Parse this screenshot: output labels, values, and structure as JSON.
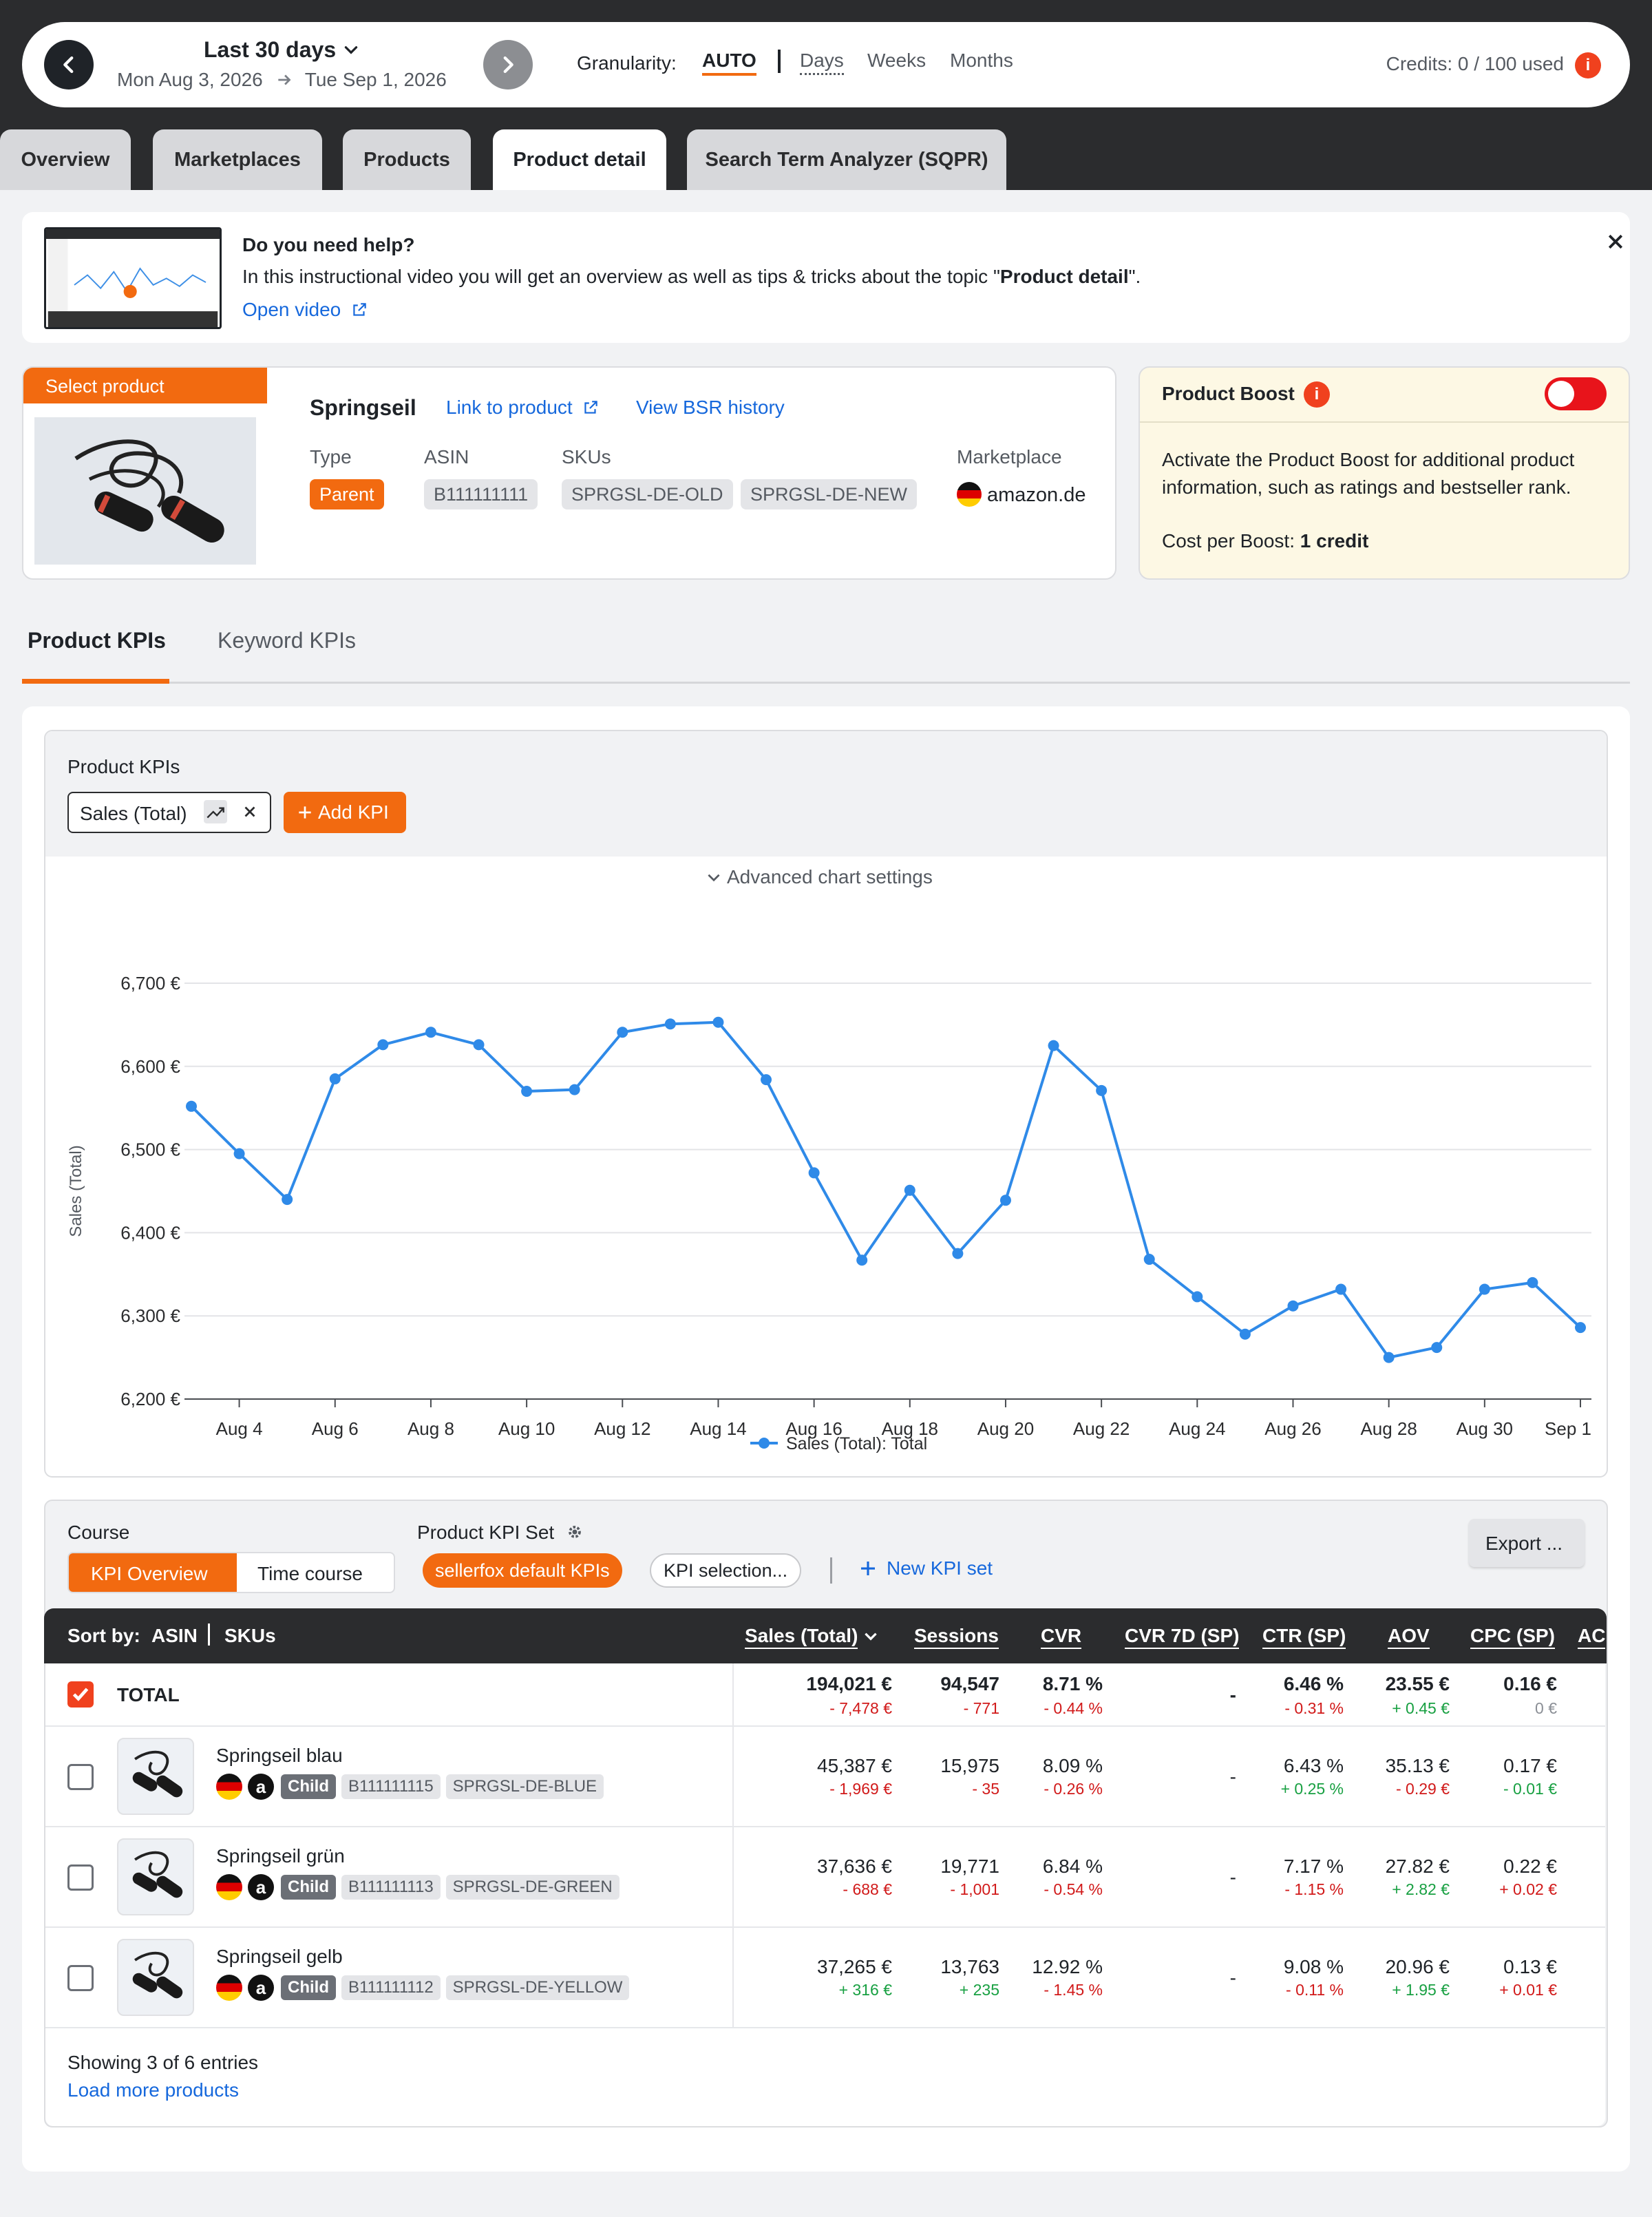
{
  "header": {
    "range_label": "Last 30 days",
    "date_from": "Mon Aug 3, 2026",
    "date_to": "Tue Sep 1, 2026",
    "granularity_label": "Granularity:",
    "granularity_options": [
      "AUTO",
      "Days",
      "Weeks",
      "Months"
    ],
    "granularity_selected": "AUTO",
    "credits": "Credits: 0 / 100 used"
  },
  "tabs": [
    "Overview",
    "Marketplaces",
    "Products",
    "Product detail",
    "Search Term Analyzer (SQPR)"
  ],
  "active_tab": "Product detail",
  "help": {
    "title": "Do you need help?",
    "text_prefix": "In this instructional video you will get an overview as well as tips & tricks about the topic \"",
    "text_bold": "Product detail",
    "text_suffix": "\".",
    "link": "Open video"
  },
  "product": {
    "select_label": "Select product",
    "name": "Springseil",
    "link_product": "Link to product",
    "link_bsr": "View BSR history",
    "type_label": "Type",
    "type_value": "Parent",
    "asin_label": "ASIN",
    "asin_value": "B111111111",
    "skus_label": "SKUs",
    "skus": [
      "SPRGSL-DE-OLD",
      "SPRGSL-DE-NEW"
    ],
    "marketplace_label": "Marketplace",
    "marketplace_value": "amazon.de"
  },
  "boost": {
    "title": "Product Boost",
    "text": "Activate the Product Boost for additional product information, such as ratings and bestseller rank.",
    "cost_label": "Cost per Boost:",
    "cost_value": "1 credit",
    "enabled": false
  },
  "kpi_tabs": [
    "Product KPIs",
    "Keyword KPIs"
  ],
  "kpi_active": "Product KPIs",
  "chart_panel": {
    "title": "Product KPIs",
    "kpi_chip": "Sales (Total)",
    "add_kpi": "Add KPI",
    "advanced": "Advanced chart settings"
  },
  "chart_data": {
    "type": "line",
    "title": "",
    "xlabel": "",
    "ylabel": "Sales (Total)",
    "ylim": [
      6200,
      6700
    ],
    "y_ticks": [
      "6,200 €",
      "6,300 €",
      "6,400 €",
      "6,500 €",
      "6,600 €",
      "6,700 €"
    ],
    "x_tick_labels": [
      "Aug 4",
      "Aug 6",
      "Aug 8",
      "Aug 10",
      "Aug 12",
      "Aug 14",
      "Aug 16",
      "Aug 18",
      "Aug 20",
      "Aug 22",
      "Aug 24",
      "Aug 26",
      "Aug 28",
      "Aug 30",
      "Sep 1"
    ],
    "grid": true,
    "legend_position": "bottom-center",
    "color": "#2f8ae8",
    "x": [
      "Aug 3",
      "Aug 4",
      "Aug 5",
      "Aug 6",
      "Aug 7",
      "Aug 8",
      "Aug 9",
      "Aug 10",
      "Aug 11",
      "Aug 12",
      "Aug 13",
      "Aug 14",
      "Aug 15",
      "Aug 16",
      "Aug 17",
      "Aug 18",
      "Aug 19",
      "Aug 20",
      "Aug 21",
      "Aug 22",
      "Aug 23",
      "Aug 24",
      "Aug 25",
      "Aug 26",
      "Aug 27",
      "Aug 28",
      "Aug 29",
      "Aug 30",
      "Aug 31",
      "Sep 1"
    ],
    "series": [
      {
        "name": "Sales (Total): Total",
        "values": [
          6552,
          6495,
          6440,
          6585,
          6626,
          6641,
          6626,
          6570,
          6572,
          6641,
          6651,
          6653,
          6584,
          6472,
          6367,
          6451,
          6375,
          6439,
          6625,
          6571,
          6368,
          6323,
          6278,
          6312,
          6332,
          6250,
          6262,
          6332,
          6340,
          6286
        ]
      }
    ]
  },
  "course": {
    "label": "Course",
    "options": [
      "KPI Overview",
      "Time course"
    ],
    "selected": "KPI Overview",
    "kpi_set_label": "Product KPI Set",
    "kpi_set_chip": "sellerfox default KPIs",
    "kpi_selection": "KPI selection...",
    "new_kpi_set": "New KPI set",
    "export": "Export ..."
  },
  "table": {
    "sort_label": "Sort by:",
    "sort_options": [
      "ASIN",
      "SKUs"
    ],
    "columns": [
      "Sales (Total)",
      "Sessions",
      "CVR",
      "CVR 7D (SP)",
      "CTR (SP)",
      "AOV",
      "CPC (SP)",
      "AC"
    ],
    "total": {
      "label": "TOTAL",
      "values": [
        "194,021 €",
        "94,547",
        "8.71 %",
        "-",
        "6.46 %",
        "23.55 €",
        "0.16 €"
      ],
      "deltas": [
        "- 7,478 €",
        "- 771",
        "- 0.44 %",
        "",
        "- 0.31 %",
        "+ 0.45 €",
        "0 €"
      ],
      "delta_colors": [
        "red",
        "red",
        "red",
        "",
        "red",
        "green",
        "gray"
      ]
    },
    "rows": [
      {
        "name": "Springseil blau",
        "type": "Child",
        "asin": "B111111115",
        "sku": "SPRGSL-DE-BLUE",
        "values": [
          "45,387 €",
          "15,975",
          "8.09 %",
          "-",
          "6.43 %",
          "35.13 €",
          "0.17 €"
        ],
        "deltas": [
          "- 1,969 €",
          "- 35",
          "- 0.26 %",
          "",
          "+ 0.25 %",
          "- 0.29 €",
          "- 0.01 €"
        ],
        "delta_colors": [
          "red",
          "red",
          "red",
          "",
          "green",
          "red",
          "green"
        ]
      },
      {
        "name": "Springseil grün",
        "type": "Child",
        "asin": "B111111113",
        "sku": "SPRGSL-DE-GREEN",
        "values": [
          "37,636 €",
          "19,771",
          "6.84 %",
          "-",
          "7.17 %",
          "27.82 €",
          "0.22 €"
        ],
        "deltas": [
          "- 688 €",
          "- 1,001",
          "- 0.54 %",
          "",
          "- 1.15 %",
          "+ 2.82 €",
          "+ 0.02 €"
        ],
        "delta_colors": [
          "red",
          "red",
          "red",
          "",
          "red",
          "green",
          "red"
        ]
      },
      {
        "name": "Springseil gelb",
        "type": "Child",
        "asin": "B111111112",
        "sku": "SPRGSL-DE-YELLOW",
        "values": [
          "37,265 €",
          "13,763",
          "12.92 %",
          "-",
          "9.08 %",
          "20.96 €",
          "0.13 €"
        ],
        "deltas": [
          "+ 316 €",
          "+ 235",
          "- 1.45 %",
          "",
          "- 0.11 %",
          "+ 1.95 €",
          "+ 0.01 €"
        ],
        "delta_colors": [
          "green",
          "green",
          "red",
          "",
          "red",
          "green",
          "red"
        ]
      }
    ],
    "showing": "Showing 3 of 6 entries",
    "load_more": "Load more products"
  }
}
